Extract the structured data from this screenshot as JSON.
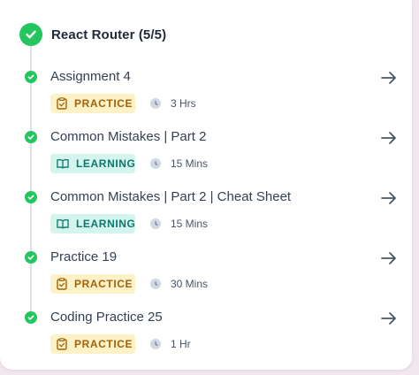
{
  "section": {
    "title": "React Router (5/5)"
  },
  "items": [
    {
      "title": "Assignment 4",
      "type": "PRACTICE",
      "duration": "3 Hrs",
      "completed": true
    },
    {
      "title": "Common Mistakes | Part 2",
      "type": "LEARNING",
      "duration": "15 Mins",
      "completed": true
    },
    {
      "title": "Common Mistakes | Part 2 | Cheat Sheet",
      "type": "LEARNING",
      "duration": "15 Mins",
      "completed": true
    },
    {
      "title": "Practice 19",
      "type": "PRACTICE",
      "duration": "30 Mins",
      "completed": true
    },
    {
      "title": "Coding Practice 25",
      "type": "PRACTICE",
      "duration": "1 Hr",
      "completed": true
    }
  ],
  "icons": {
    "complete": "check-circle-icon",
    "practice": "clipboard-check-icon",
    "learning": "open-book-icon",
    "duration": "clock-icon",
    "open": "arrow-right-icon"
  },
  "colors": {
    "success": "#22c55e",
    "practice_bg": "#fdf1c7",
    "practice_text": "#a1620b",
    "learning_bg": "#d3f5ee",
    "learning_text": "#0f766e",
    "arrow": "#475569"
  }
}
